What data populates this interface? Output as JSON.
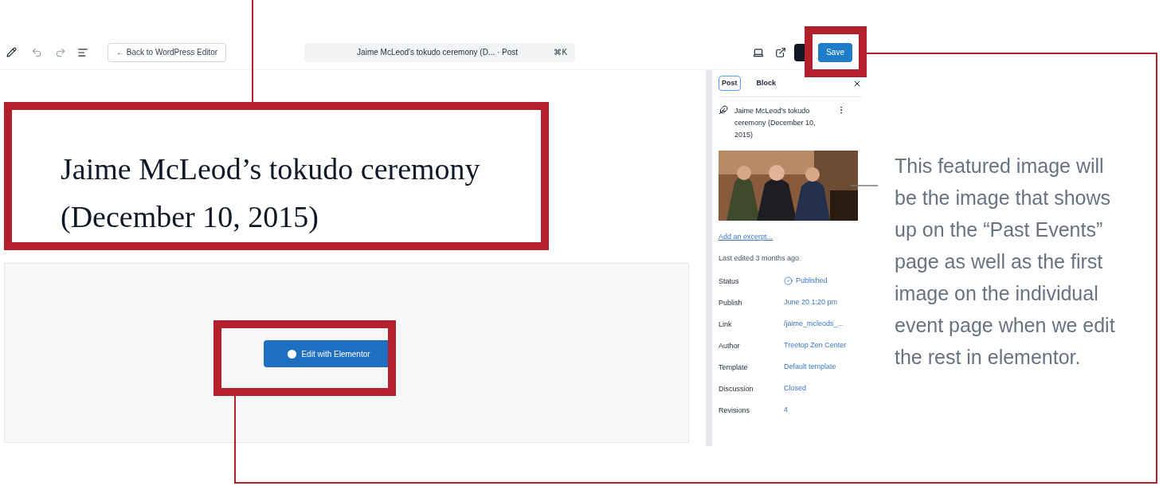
{
  "toolbar": {
    "back_button": "← Back to WordPress Editor",
    "document_title": "Jaime McLeod's tokudo ceremony (D... · Post",
    "shortcut": "⌘K",
    "save_button": "Save"
  },
  "editor": {
    "post_title": "Jaime McLeod’s tokudo ceremony (December 10, 2015)",
    "edit_button": "Edit with Elementor"
  },
  "sidebar": {
    "tabs": [
      {
        "label": "Post",
        "selected": true
      },
      {
        "label": "Block",
        "selected": false
      }
    ],
    "post_name": "Jaime McLeod's tokudo ceremony (December 10, 2015)",
    "excerpt_link": "Add an excerpt...",
    "last_edited": "Last edited 3 months ago.",
    "fields": [
      {
        "label": "Status",
        "value": "Published",
        "kind": "status"
      },
      {
        "label": "Publish",
        "value": "June 20 1:20 pm",
        "kind": "link"
      },
      {
        "label": "Link",
        "value": "/jaime_mcleods_...",
        "kind": "link"
      },
      {
        "label": "Author",
        "value": "Treetop Zen Center",
        "kind": "link"
      },
      {
        "label": "Template",
        "value": "Default template",
        "kind": "link"
      },
      {
        "label": "Discussion",
        "value": "Closed",
        "kind": "link"
      },
      {
        "label": "Revisions",
        "value": "4",
        "kind": "link"
      }
    ]
  },
  "annotation": "This featured image will be the image that shows up on the “Past Events” page as well as the first image on the individual event page when we edit the rest in elementor."
}
